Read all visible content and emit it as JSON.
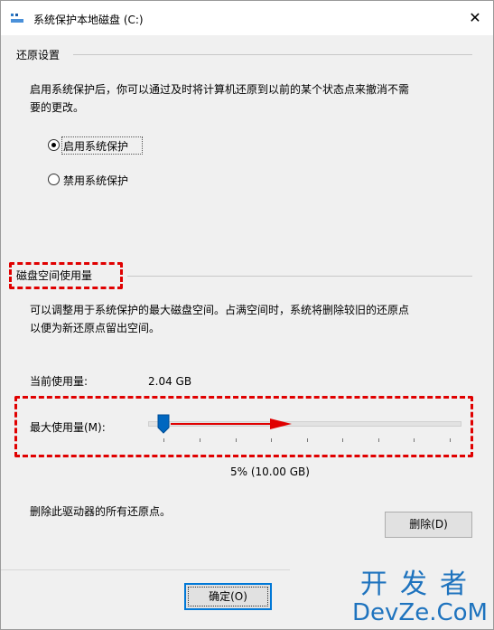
{
  "window": {
    "title": "系统保护本地磁盘 (C:)",
    "close_glyph": "✕"
  },
  "restore_settings": {
    "group_label": "还原设置",
    "desc_line1": "启用系统保护后，你可以通过及时将计算机还原到以前的某个状态点来撤消不需",
    "desc_line2": "要的更改。",
    "options": [
      {
        "label": "启用系统保护",
        "selected": true
      },
      {
        "label": "禁用系统保护",
        "selected": false
      }
    ]
  },
  "disk_usage": {
    "group_label": "磁盘空间使用量",
    "desc_line1": "可以调整用于系统保护的最大磁盘空间。占满空间时，系统将删除较旧的还原点",
    "desc_line2": "以便为新还原点留出空间。",
    "current_label": "当前使用量:",
    "current_value": "2.04 GB",
    "max_label": "最大使用量(M):",
    "slider_percent": 5,
    "slider_value_text": "5% (10.00 GB)"
  },
  "delete_section": {
    "desc": "删除此驱动器的所有还原点。",
    "delete_button": "删除(D)"
  },
  "footer": {
    "ok_button": "确定(O)"
  },
  "watermark": {
    "line1": "开发者",
    "line2": "DevZe.CoM"
  },
  "colors": {
    "annotation_red": "#e00000",
    "slider_thumb": "#0067c0",
    "watermark": "#1e73be"
  }
}
